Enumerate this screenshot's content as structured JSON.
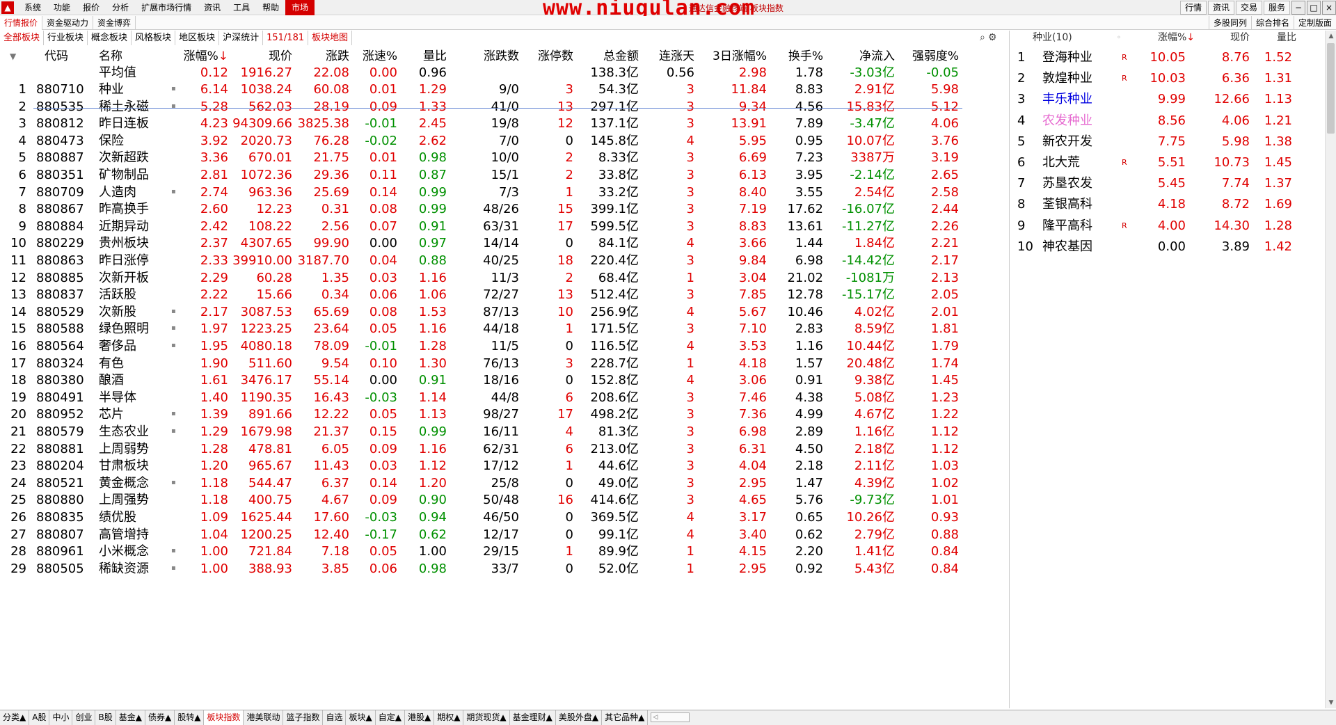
{
  "menu": {
    "items": [
      "系统",
      "功能",
      "报价",
      "分析",
      "扩展市场行情",
      "资讯",
      "工具",
      "帮助"
    ],
    "active": "市场",
    "watermark": "www.niugulan.com",
    "caption": "通达信金融终端 板块指数",
    "right_buttons": [
      "行情",
      "资讯",
      "交易",
      "服务"
    ],
    "win_buttons": [
      "−",
      "□",
      "×"
    ]
  },
  "tabs_top": {
    "left": [
      "行情报价",
      "资金驱动力",
      "资金博弈"
    ],
    "right": [
      "多股同列",
      "综合排名",
      "定制版面"
    ]
  },
  "sector_tabs": {
    "items": [
      "全部板块",
      "行业板块",
      "概念板块",
      "风格板块",
      "地区板块",
      "沪深统计"
    ],
    "count_current": "151",
    "count_total": "/181",
    "map": "板块地图"
  },
  "table": {
    "headers": {
      "code": "代码",
      "name": "名称",
      "chg": "涨幅%",
      "sort_arrow": "↓",
      "price": "现价",
      "diff": "涨跌",
      "speed": "涨速%",
      "vol_ratio": "量比",
      "updown": "涨跌数",
      "limit": "涨停数",
      "amount": "总金额",
      "days": "连涨天",
      "chg3": "3日涨幅%",
      "turnover": "换手%",
      "inflow": "净流入",
      "strength": "强弱度%"
    },
    "avg": {
      "label": "平均值",
      "chg": "0.12",
      "price": "1916.27",
      "diff": "22.08",
      "speed": "0.00",
      "vol_ratio": "0.96",
      "amount": "138.3亿",
      "days": "0.56",
      "chg3": "2.98",
      "turnover": "1.78",
      "inflow": "-3.03亿",
      "strength": "-0.05"
    },
    "rows": [
      {
        "no": "1",
        "code": "880710",
        "name": "种业",
        "m": true,
        "chg": "6.14",
        "price": "1038.24",
        "diff": "60.08",
        "speed": "0.01",
        "vr": "1.29",
        "ud": "9/0",
        "lim": "3",
        "amt": "54.3亿",
        "days": "3",
        "c3": "11.84",
        "to": "8.83",
        "inf": "2.91亿",
        "str": "5.98"
      },
      {
        "no": "2",
        "code": "880535",
        "name": "稀土永磁",
        "m": true,
        "chg": "5.28",
        "price": "562.03",
        "diff": "28.19",
        "speed": "0.09",
        "vr": "1.33",
        "ud": "41/0",
        "lim": "13",
        "amt": "297.1亿",
        "days": "3",
        "c3": "9.34",
        "to": "4.56",
        "inf": "15.83亿",
        "str": "5.12"
      },
      {
        "no": "3",
        "code": "880812",
        "name": "昨日连板",
        "m": false,
        "chg": "4.23",
        "price": "94309.66",
        "diff": "3825.38",
        "speed": "-0.01",
        "vr": "2.45",
        "ud": "19/8",
        "lim": "12",
        "amt": "137.1亿",
        "days": "3",
        "c3": "13.91",
        "to": "7.89",
        "inf": "-3.47亿",
        "str": "4.06"
      },
      {
        "no": "4",
        "code": "880473",
        "name": "保险",
        "m": false,
        "chg": "3.92",
        "price": "2020.73",
        "diff": "76.28",
        "speed": "-0.02",
        "vr": "2.62",
        "ud": "7/0",
        "lim": "0",
        "amt": "145.8亿",
        "days": "4",
        "c3": "5.95",
        "to": "0.95",
        "inf": "10.07亿",
        "str": "3.76"
      },
      {
        "no": "5",
        "code": "880887",
        "name": "次新超跌",
        "m": false,
        "chg": "3.36",
        "price": "670.01",
        "diff": "21.75",
        "speed": "0.01",
        "vr": "0.98",
        "ud": "10/0",
        "lim": "2",
        "amt": "8.33亿",
        "days": "3",
        "c3": "6.69",
        "to": "7.23",
        "inf": "3387万",
        "str": "3.19"
      },
      {
        "no": "6",
        "code": "880351",
        "name": "矿物制品",
        "m": false,
        "chg": "2.81",
        "price": "1072.36",
        "diff": "29.36",
        "speed": "0.11",
        "vr": "0.87",
        "ud": "15/1",
        "lim": "2",
        "amt": "33.8亿",
        "days": "3",
        "c3": "6.13",
        "to": "3.95",
        "inf": "-2.14亿",
        "str": "2.65"
      },
      {
        "no": "7",
        "code": "880709",
        "name": "人造肉",
        "m": true,
        "chg": "2.74",
        "price": "963.36",
        "diff": "25.69",
        "speed": "0.14",
        "vr": "0.99",
        "ud": "7/3",
        "lim": "1",
        "amt": "33.2亿",
        "days": "3",
        "c3": "8.40",
        "to": "3.55",
        "inf": "2.54亿",
        "str": "2.58"
      },
      {
        "no": "8",
        "code": "880867",
        "name": "昨高换手",
        "m": false,
        "chg": "2.60",
        "price": "12.23",
        "diff": "0.31",
        "speed": "0.08",
        "vr": "0.99",
        "ud": "48/26",
        "lim": "15",
        "amt": "399.1亿",
        "days": "3",
        "c3": "7.19",
        "to": "17.62",
        "inf": "-16.07亿",
        "str": "2.44"
      },
      {
        "no": "9",
        "code": "880884",
        "name": "近期异动",
        "m": false,
        "chg": "2.42",
        "price": "108.22",
        "diff": "2.56",
        "speed": "0.07",
        "vr": "0.91",
        "ud": "63/31",
        "lim": "17",
        "amt": "599.5亿",
        "days": "3",
        "c3": "8.83",
        "to": "13.61",
        "inf": "-11.27亿",
        "str": "2.26"
      },
      {
        "no": "10",
        "code": "880229",
        "name": "贵州板块",
        "m": false,
        "chg": "2.37",
        "price": "4307.65",
        "diff": "99.90",
        "speed": "0.00",
        "vr": "0.97",
        "ud": "14/14",
        "lim": "0",
        "amt": "84.1亿",
        "days": "4",
        "c3": "3.66",
        "to": "1.44",
        "inf": "1.84亿",
        "str": "2.21"
      },
      {
        "no": "11",
        "code": "880863",
        "name": "昨日涨停",
        "m": false,
        "chg": "2.33",
        "price": "39910.00",
        "diff": "3187.70",
        "speed": "0.04",
        "vr": "0.88",
        "ud": "40/25",
        "lim": "18",
        "amt": "220.4亿",
        "days": "3",
        "c3": "9.84",
        "to": "6.98",
        "inf": "-14.42亿",
        "str": "2.17"
      },
      {
        "no": "12",
        "code": "880885",
        "name": "次新开板",
        "m": false,
        "chg": "2.29",
        "price": "60.28",
        "diff": "1.35",
        "speed": "0.03",
        "vr": "1.16",
        "ud": "11/3",
        "lim": "2",
        "amt": "68.4亿",
        "days": "1",
        "c3": "3.04",
        "to": "21.02",
        "inf": "-1081万",
        "str": "2.13"
      },
      {
        "no": "13",
        "code": "880837",
        "name": "活跃股",
        "m": false,
        "chg": "2.22",
        "price": "15.66",
        "diff": "0.34",
        "speed": "0.06",
        "vr": "1.06",
        "ud": "72/27",
        "lim": "13",
        "amt": "512.4亿",
        "days": "3",
        "c3": "7.85",
        "to": "12.78",
        "inf": "-15.17亿",
        "str": "2.05"
      },
      {
        "no": "14",
        "code": "880529",
        "name": "次新股",
        "m": true,
        "chg": "2.17",
        "price": "3087.53",
        "diff": "65.69",
        "speed": "0.08",
        "vr": "1.53",
        "ud": "87/13",
        "lim": "10",
        "amt": "256.9亿",
        "days": "4",
        "c3": "5.67",
        "to": "10.46",
        "inf": "4.02亿",
        "str": "2.01"
      },
      {
        "no": "15",
        "code": "880588",
        "name": "绿色照明",
        "m": true,
        "chg": "1.97",
        "price": "1223.25",
        "diff": "23.64",
        "speed": "0.05",
        "vr": "1.16",
        "ud": "44/18",
        "lim": "1",
        "amt": "171.5亿",
        "days": "3",
        "c3": "7.10",
        "to": "2.83",
        "inf": "8.59亿",
        "str": "1.81"
      },
      {
        "no": "16",
        "code": "880564",
        "name": "奢侈品",
        "m": true,
        "chg": "1.95",
        "price": "4080.18",
        "diff": "78.09",
        "speed": "-0.01",
        "vr": "1.28",
        "ud": "11/5",
        "lim": "0",
        "amt": "116.5亿",
        "days": "4",
        "c3": "3.53",
        "to": "1.16",
        "inf": "10.44亿",
        "str": "1.79"
      },
      {
        "no": "17",
        "code": "880324",
        "name": "有色",
        "m": false,
        "chg": "1.90",
        "price": "511.60",
        "diff": "9.54",
        "speed": "0.10",
        "vr": "1.30",
        "ud": "76/13",
        "lim": "3",
        "amt": "228.7亿",
        "days": "1",
        "c3": "4.18",
        "to": "1.57",
        "inf": "20.48亿",
        "str": "1.74"
      },
      {
        "no": "18",
        "code": "880380",
        "name": "酿酒",
        "m": false,
        "chg": "1.61",
        "price": "3476.17",
        "diff": "55.14",
        "speed": "0.00",
        "vr": "0.91",
        "ud": "18/16",
        "lim": "0",
        "amt": "152.8亿",
        "days": "4",
        "c3": "3.06",
        "to": "0.91",
        "inf": "9.38亿",
        "str": "1.45"
      },
      {
        "no": "19",
        "code": "880491",
        "name": "半导体",
        "m": false,
        "chg": "1.40",
        "price": "1190.35",
        "diff": "16.43",
        "speed": "-0.03",
        "vr": "1.14",
        "ud": "44/8",
        "lim": "6",
        "amt": "208.6亿",
        "days": "3",
        "c3": "7.46",
        "to": "4.38",
        "inf": "5.08亿",
        "str": "1.23"
      },
      {
        "no": "20",
        "code": "880952",
        "name": "芯片",
        "m": true,
        "chg": "1.39",
        "price": "891.66",
        "diff": "12.22",
        "speed": "0.05",
        "vr": "1.13",
        "ud": "98/27",
        "lim": "17",
        "amt": "498.2亿",
        "days": "3",
        "c3": "7.36",
        "to": "4.99",
        "inf": "4.67亿",
        "str": "1.22"
      },
      {
        "no": "21",
        "code": "880579",
        "name": "生态农业",
        "m": true,
        "chg": "1.29",
        "price": "1679.98",
        "diff": "21.37",
        "speed": "0.15",
        "vr": "0.99",
        "ud": "16/11",
        "lim": "4",
        "amt": "81.3亿",
        "days": "3",
        "c3": "6.98",
        "to": "2.89",
        "inf": "1.16亿",
        "str": "1.12"
      },
      {
        "no": "22",
        "code": "880881",
        "name": "上周弱势",
        "m": false,
        "chg": "1.28",
        "price": "478.81",
        "diff": "6.05",
        "speed": "0.09",
        "vr": "1.16",
        "ud": "62/31",
        "lim": "6",
        "amt": "213.0亿",
        "days": "3",
        "c3": "6.31",
        "to": "4.50",
        "inf": "2.18亿",
        "str": "1.12"
      },
      {
        "no": "23",
        "code": "880204",
        "name": "甘肃板块",
        "m": false,
        "chg": "1.20",
        "price": "965.67",
        "diff": "11.43",
        "speed": "0.03",
        "vr": "1.12",
        "ud": "17/12",
        "lim": "1",
        "amt": "44.6亿",
        "days": "3",
        "c3": "4.04",
        "to": "2.18",
        "inf": "2.11亿",
        "str": "1.03"
      },
      {
        "no": "24",
        "code": "880521",
        "name": "黄金概念",
        "m": true,
        "chg": "1.18",
        "price": "544.47",
        "diff": "6.37",
        "speed": "0.14",
        "vr": "1.20",
        "ud": "25/8",
        "lim": "0",
        "amt": "49.0亿",
        "days": "3",
        "c3": "2.95",
        "to": "1.47",
        "inf": "4.39亿",
        "str": "1.02"
      },
      {
        "no": "25",
        "code": "880880",
        "name": "上周强势",
        "m": false,
        "chg": "1.18",
        "price": "400.75",
        "diff": "4.67",
        "speed": "0.09",
        "vr": "0.90",
        "ud": "50/48",
        "lim": "16",
        "amt": "414.6亿",
        "days": "3",
        "c3": "4.65",
        "to": "5.76",
        "inf": "-9.73亿",
        "str": "1.01"
      },
      {
        "no": "26",
        "code": "880835",
        "name": "绩优股",
        "m": false,
        "chg": "1.09",
        "price": "1625.44",
        "diff": "17.60",
        "speed": "-0.03",
        "vr": "0.94",
        "ud": "46/50",
        "lim": "0",
        "amt": "369.5亿",
        "days": "4",
        "c3": "3.17",
        "to": "0.65",
        "inf": "10.26亿",
        "str": "0.93"
      },
      {
        "no": "27",
        "code": "880807",
        "name": "高管增持",
        "m": false,
        "chg": "1.04",
        "price": "1200.25",
        "diff": "12.40",
        "speed": "-0.17",
        "vr": "0.62",
        "ud": "12/17",
        "lim": "0",
        "amt": "99.1亿",
        "days": "4",
        "c3": "3.40",
        "to": "0.62",
        "inf": "2.79亿",
        "str": "0.88"
      },
      {
        "no": "28",
        "code": "880961",
        "name": "小米概念",
        "m": true,
        "chg": "1.00",
        "price": "721.84",
        "diff": "7.18",
        "speed": "0.05",
        "vr": "1.00",
        "ud": "29/15",
        "lim": "1",
        "amt": "89.9亿",
        "days": "1",
        "c3": "4.15",
        "to": "2.20",
        "inf": "1.41亿",
        "str": "0.84"
      },
      {
        "no": "29",
        "code": "880505",
        "name": "稀缺资源",
        "m": true,
        "chg": "1.00",
        "price": "388.93",
        "diff": "3.85",
        "speed": "0.06",
        "vr": "0.98",
        "ud": "33/7",
        "lim": "0",
        "amt": "52.0亿",
        "days": "1",
        "c3": "2.95",
        "to": "0.92",
        "inf": "5.43亿",
        "str": "0.84"
      }
    ]
  },
  "right_panel": {
    "title": "种业(10)",
    "dot": "◦",
    "col_chg": "涨幅%",
    "sort_arrow": "↓",
    "col_price": "现价",
    "col_vr": "量比",
    "rows": [
      {
        "no": "1",
        "name": "登海种业",
        "r": "R",
        "chg": "10.05",
        "price": "8.76",
        "vr": "1.52",
        "nc": "bl",
        "cc": "up",
        "pc": "up",
        "vc": "up"
      },
      {
        "no": "2",
        "name": "敦煌种业",
        "r": "R",
        "chg": "10.03",
        "price": "6.36",
        "vr": "1.31",
        "nc": "bl",
        "cc": "up",
        "pc": "up",
        "vc": "up"
      },
      {
        "no": "3",
        "name": "丰乐种业",
        "r": "",
        "chg": "9.99",
        "price": "12.66",
        "vr": "1.13",
        "nc": "blue",
        "cc": "up",
        "pc": "up",
        "vc": "up"
      },
      {
        "no": "4",
        "name": "农发种业",
        "r": "",
        "chg": "8.56",
        "price": "4.06",
        "vr": "1.21",
        "nc": "pink",
        "cc": "up",
        "pc": "up",
        "vc": "up"
      },
      {
        "no": "5",
        "name": "新农开发",
        "r": "",
        "chg": "7.75",
        "price": "5.98",
        "vr": "1.38",
        "nc": "bl",
        "cc": "up",
        "pc": "up",
        "vc": "up"
      },
      {
        "no": "6",
        "name": "北大荒",
        "r": "R",
        "chg": "5.51",
        "price": "10.73",
        "vr": "1.45",
        "nc": "bl",
        "cc": "up",
        "pc": "up",
        "vc": "up"
      },
      {
        "no": "7",
        "name": "苏垦农发",
        "r": "",
        "chg": "5.45",
        "price": "7.74",
        "vr": "1.37",
        "nc": "bl",
        "cc": "up",
        "pc": "up",
        "vc": "up"
      },
      {
        "no": "8",
        "name": "荃银高科",
        "r": "",
        "chg": "4.18",
        "price": "8.72",
        "vr": "1.69",
        "nc": "bl",
        "cc": "up",
        "pc": "up",
        "vc": "up"
      },
      {
        "no": "9",
        "name": "隆平高科",
        "r": "R",
        "chg": "4.00",
        "price": "14.30",
        "vr": "1.28",
        "nc": "bl",
        "cc": "up",
        "pc": "up",
        "vc": "up"
      },
      {
        "no": "10",
        "name": "神农基因",
        "r": "",
        "chg": "0.00",
        "price": "3.89",
        "vr": "1.42",
        "nc": "bl",
        "cc": "bl",
        "pc": "bl",
        "vc": "up"
      }
    ]
  },
  "bottom_tabs": {
    "items": [
      "分类▲",
      "A股",
      "中小",
      "创业",
      "B股",
      "基金▲",
      "债券▲",
      "股转▲",
      "板块指数",
      "港美联动",
      "篮子指数",
      "自选",
      "板块▲",
      "自定▲",
      "港股▲",
      "期权▲",
      "期货现货▲",
      "基金理财▲",
      "美股外盘▲",
      "其它品种▲"
    ],
    "active_index": 8,
    "scroll_arrow": "◁"
  },
  "tools": {
    "search_icon": "search-icon",
    "gear_icon": "gear-icon",
    "search_glyph": "⌕",
    "gear_glyph": "⚙"
  },
  "colors": {
    "up": "#e00000",
    "down": "#009000",
    "accent": "#d40000",
    "select_line": "#5a7fd0"
  }
}
